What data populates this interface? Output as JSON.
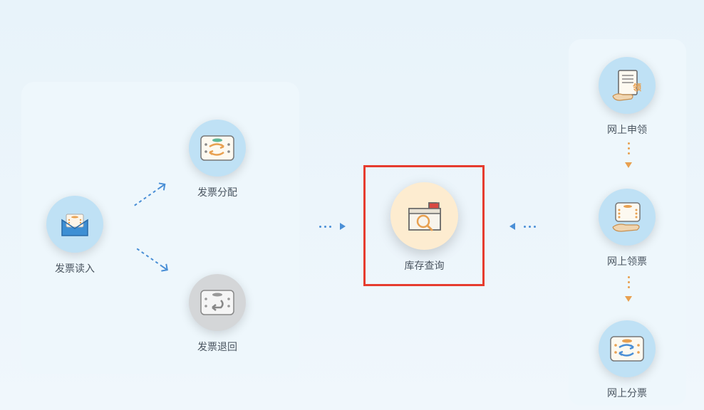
{
  "left_panel": {
    "read_in": {
      "label": "发票读入",
      "icon": "invoice-envelope-icon"
    },
    "distribute": {
      "label": "发票分配",
      "icon": "invoice-swap-icon"
    },
    "return": {
      "label": "发票退回",
      "icon": "invoice-back-icon"
    }
  },
  "center": {
    "inventory_query": {
      "label": "库存查询",
      "icon": "inventory-search-icon"
    }
  },
  "right_panel": {
    "online_apply": {
      "label": "网上申领",
      "icon": "document-hand-icon"
    },
    "online_receive": {
      "label": "网上领票",
      "icon": "ticket-hand-icon"
    },
    "online_split": {
      "label": "网上分票",
      "icon": "ticket-split-icon"
    }
  },
  "colors": {
    "highlight": "#e63c2e",
    "arrow_blue": "#4a8fd6",
    "arrow_orange": "#e8a050"
  }
}
